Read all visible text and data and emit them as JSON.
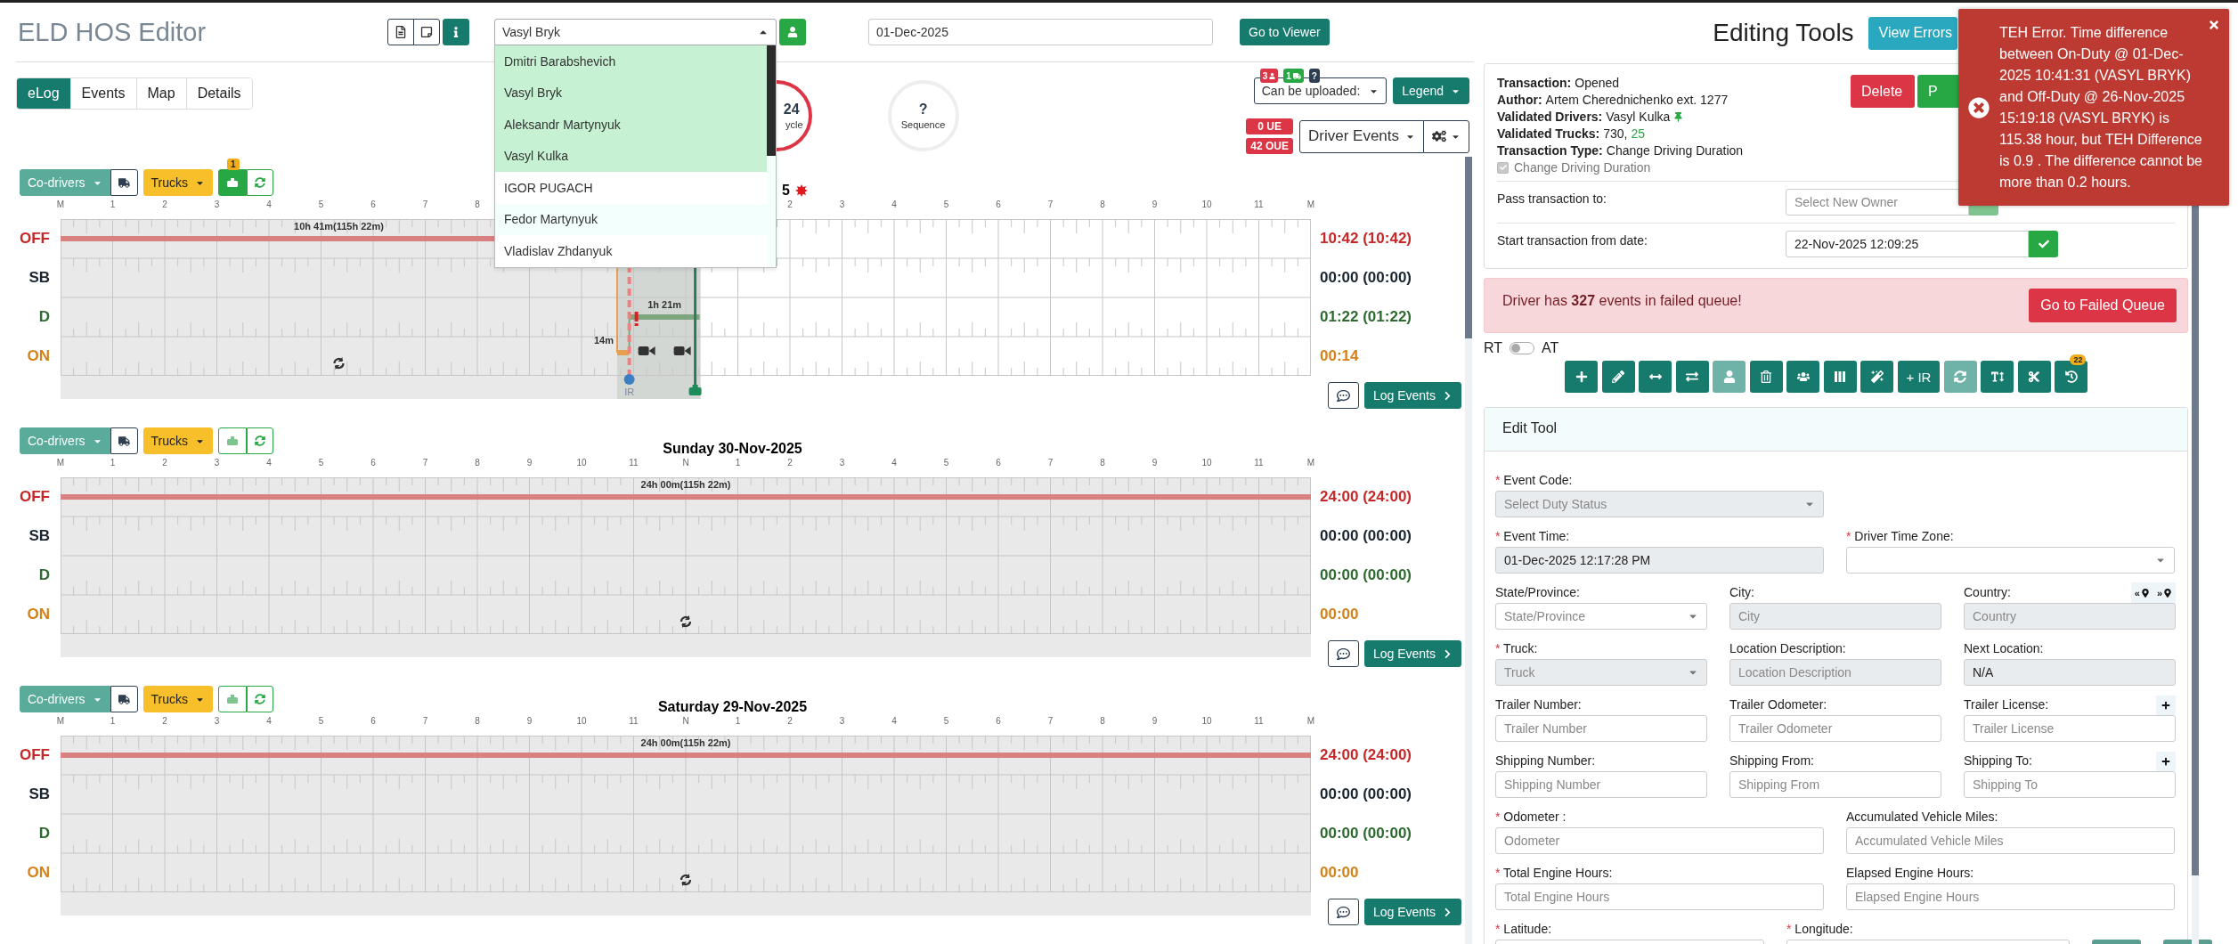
{
  "header": {
    "title": "ELD HOS Editor"
  },
  "driver_select": {
    "value": "Vasyl Bryk",
    "expanded": true,
    "options": [
      {
        "name": "Dmitri Barabshevich",
        "highlighted": true,
        "hovered": false
      },
      {
        "name": "Vasyl Bryk",
        "highlighted": true,
        "hovered": false
      },
      {
        "name": "Aleksandr Martynyuk",
        "highlighted": true,
        "hovered": false
      },
      {
        "name": "Vasyl Kulka",
        "highlighted": true,
        "hovered": false
      },
      {
        "name": "IGOR PUGACH",
        "highlighted": false,
        "hovered": false
      },
      {
        "name": "Fedor Martynyuk",
        "highlighted": false,
        "hovered": true
      },
      {
        "name": "Vladislav Zhdanyuk",
        "highlighted": false,
        "hovered": false
      }
    ]
  },
  "date_field": {
    "value": "01-Dec-2025"
  },
  "viewer_button": "Go to Viewer",
  "tabs": [
    {
      "label": "eLog",
      "selected": true
    },
    {
      "label": "Events",
      "selected": false
    },
    {
      "label": "Map",
      "selected": false
    },
    {
      "label": "Details",
      "selected": false
    }
  ],
  "gauges": [
    {
      "kind": "cycle",
      "value": "24",
      "label": "ycle"
    },
    {
      "kind": "sequence",
      "value": "?",
      "label": "Sequence"
    }
  ],
  "upload": {
    "label": "Can be uploaded:",
    "badges": [
      {
        "kind": "drivers",
        "text": "3"
      },
      {
        "kind": "trucks",
        "text": "1"
      },
      {
        "kind": "help",
        "text": "?"
      }
    ]
  },
  "legend_button": "Legend",
  "error_badges": [
    "0 UE",
    "42 OUE"
  ],
  "events_select": "Driver Events",
  "days": [
    {
      "title": "5",
      "violation": true,
      "codrivers": "Co-drivers",
      "trucks": "Trucks",
      "engine_active": true,
      "engine_badge": "1",
      "hours": [
        "M",
        "1",
        "2",
        "3",
        "4",
        "5",
        "6",
        "7",
        "8"
      ],
      "hours_end": [
        "2",
        "3",
        "4",
        "5",
        "6",
        "7",
        "8",
        "9",
        "10",
        "11",
        "M"
      ],
      "ir_label": "IR",
      "rows": [
        {
          "kind": "off",
          "label": "OFF",
          "total": "10:42 (10:42)"
        },
        {
          "kind": "sb",
          "label": "SB",
          "total": "00:00 (00:00)"
        },
        {
          "kind": "d",
          "label": "D",
          "total": "01:22 (01:22)"
        },
        {
          "kind": "on",
          "label": "ON",
          "total": "00:14"
        }
      ],
      "segments": [
        {
          "kind": "off",
          "label": "10h 41m(115h 22m)"
        },
        {
          "kind": "on",
          "label": "14m"
        },
        {
          "kind": "d",
          "label": "1h 21m"
        }
      ],
      "log_events": "Log Events"
    },
    {
      "title": "Sunday 30-Nov-2025",
      "violation": false,
      "codrivers": "Co-drivers",
      "trucks": "Trucks",
      "engine_active": false,
      "hours": [
        "M",
        "1",
        "2",
        "3",
        "4",
        "5",
        "6",
        "7",
        "8",
        "9",
        "10",
        "11",
        "N",
        "1",
        "2",
        "3",
        "4",
        "5",
        "6",
        "7",
        "8",
        "9",
        "10",
        "11",
        "M"
      ],
      "rows": [
        {
          "kind": "off",
          "label": "OFF",
          "total": "24:00 (24:00)"
        },
        {
          "kind": "sb",
          "label": "SB",
          "total": "00:00 (00:00)"
        },
        {
          "kind": "d",
          "label": "D",
          "total": "00:00 (00:00)"
        },
        {
          "kind": "on",
          "label": "ON",
          "total": "00:00"
        }
      ],
      "segments": [
        {
          "kind": "off",
          "label": "24h 00m(115h 22m)"
        }
      ],
      "log_events": "Log Events"
    },
    {
      "title": "Saturday 29-Nov-2025",
      "violation": false,
      "codrivers": "Co-drivers",
      "trucks": "Trucks",
      "engine_active": false,
      "hours": [
        "M",
        "1",
        "2",
        "3",
        "4",
        "5",
        "6",
        "7",
        "8",
        "9",
        "10",
        "11",
        "N",
        "1",
        "2",
        "3",
        "4",
        "5",
        "6",
        "7",
        "8",
        "9",
        "10",
        "11",
        "M"
      ],
      "rows": [
        {
          "kind": "off",
          "label": "OFF",
          "total": "24:00 (24:00)"
        },
        {
          "kind": "sb",
          "label": "SB",
          "total": "00:00 (00:00)"
        },
        {
          "kind": "d",
          "label": "D",
          "total": "00:00 (00:00)"
        },
        {
          "kind": "on",
          "label": "ON",
          "total": "00:00"
        }
      ],
      "segments": [
        {
          "kind": "off",
          "label": "24h 00m(115h 22m)"
        }
      ],
      "log_events": "Log Events"
    }
  ],
  "editing": {
    "title": "Editing Tools",
    "view_errors": "View Errors",
    "transaction": {
      "lines": [
        {
          "label": "Transaction:",
          "value": "Opened"
        },
        {
          "label": "Author:",
          "value": "Artem Cherednichenko ext. 1277"
        },
        {
          "label": "Validated Drivers:",
          "value": "Vasyl Kulka",
          "pinned": true
        },
        {
          "label": "Validated Trucks:",
          "value": "730,",
          "extra": "25"
        },
        {
          "label": "Transaction Type:",
          "value": "Change Driving Duration"
        }
      ],
      "checkbox": {
        "label": "Change Driving Duration",
        "checked": true
      },
      "buttons": [
        {
          "kind": "delete",
          "label": "Delete"
        },
        {
          "kind": "proceed",
          "label": "P"
        }
      ],
      "pass_to": {
        "label": "Pass transaction to:",
        "placeholder": "Select New Owner"
      },
      "start_date": {
        "label": "Start transaction from date:",
        "value": "22-Nov-2025 12:09:25"
      }
    },
    "failed_alert": {
      "text": "Driver has **327** events in failed queue!",
      "button": "Go to Failed Queue"
    },
    "mode_toggle": {
      "left": "RT",
      "right": "AT",
      "on": false
    },
    "tools": [
      {
        "kind": "add",
        "disabled": false
      },
      {
        "kind": "edit",
        "disabled": false
      },
      {
        "kind": "stretch",
        "disabled": false
      },
      {
        "kind": "swap",
        "disabled": false
      },
      {
        "kind": "driver",
        "disabled": true
      },
      {
        "kind": "delete",
        "disabled": false
      },
      {
        "kind": "drivers",
        "disabled": false
      },
      {
        "kind": "split",
        "disabled": false
      },
      {
        "kind": "magic",
        "disabled": false
      },
      {
        "kind": "ir",
        "label": "+ IR",
        "disabled": false
      },
      {
        "kind": "refresh",
        "disabled": true
      },
      {
        "kind": "text",
        "disabled": false
      },
      {
        "kind": "cut",
        "disabled": false
      },
      {
        "kind": "history",
        "badge": "22",
        "disabled": false
      }
    ],
    "edit_tool": {
      "title": "Edit Tool",
      "rows": [
        {
          "kind": "single",
          "fields": [
            {
              "label": "Event Code:",
              "asterisk": "*",
              "kind": "select",
              "placeholder": "Select Duty Status",
              "disabled": true
            }
          ]
        },
        {
          "kind": "pair",
          "fields": [
            {
              "label": "Event Time:",
              "asterisk": "*",
              "kind": "text",
              "value": "01-Dec-2025 12:17:28 PM",
              "disabled": true
            },
            {
              "label": "Driver Time Zone:",
              "asterisk": "*",
              "kind": "select",
              "disabled": false
            }
          ]
        },
        {
          "kind": "triple",
          "fields": [
            {
              "label": "State/Province:",
              "kind": "select",
              "placeholder": "State/Province",
              "disabled": false
            },
            {
              "label": "City:",
              "kind": "text",
              "placeholder": "City",
              "disabled": true
            },
            {
              "label": "Country:",
              "kind": "text",
              "placeholder": "Country",
              "disabled": true,
              "locate": [
                "«",
                "»"
              ]
            }
          ]
        },
        {
          "kind": "triple",
          "fields": [
            {
              "label": "Truck:",
              "asterisk": "*",
              "kind": "select",
              "placeholder": "Truck",
              "disabled": true
            },
            {
              "label": "Location Description:",
              "kind": "text",
              "placeholder": "Location Description",
              "disabled": true
            },
            {
              "label": "Next Location:",
              "kind": "text",
              "value": "N/A",
              "disabled": true
            }
          ]
        },
        {
          "kind": "triple",
          "fields": [
            {
              "label": "Trailer Number:",
              "kind": "text",
              "placeholder": "Trailer Number",
              "disabled": false
            },
            {
              "label": "Trailer Odometer:",
              "kind": "text",
              "placeholder": "Trailer Odometer",
              "disabled": false
            },
            {
              "label": "Trailer License:",
              "kind": "text",
              "placeholder": "Trailer License",
              "disabled": false,
              "add": true
            }
          ]
        },
        {
          "kind": "triple",
          "fields": [
            {
              "label": "Shipping Number:",
              "kind": "text",
              "placeholder": "Shipping Number",
              "disabled": false
            },
            {
              "label": "Shipping From:",
              "kind": "text",
              "placeholder": "Shipping From",
              "disabled": false
            },
            {
              "label": "Shipping To:",
              "kind": "text",
              "placeholder": "Shipping To",
              "disabled": false,
              "add": true
            }
          ]
        },
        {
          "kind": "pair",
          "fields": [
            {
              "label": "Odometer :",
              "asterisk": "*",
              "kind": "text",
              "placeholder": "Odometer",
              "disabled": false
            },
            {
              "label": "Accumulated Vehicle Miles:",
              "kind": "text",
              "placeholder": "Accumulated Vehicle Miles",
              "disabled": false
            }
          ]
        },
        {
          "kind": "pair",
          "fields": [
            {
              "label": "Total Engine Hours:",
              "asterisk": "*",
              "kind": "text",
              "placeholder": "Total Engine Hours",
              "disabled": false
            },
            {
              "label": "Elapsed Engine Hours:",
              "kind": "text",
              "placeholder": "Elapsed Engine Hours",
              "disabled": false
            }
          ]
        },
        {
          "kind": "coords",
          "fields": [
            {
              "label": "Latitude:",
              "asterisk": "*",
              "kind": "text"
            },
            {
              "label": "Longitude:",
              "asterisk": "*",
              "kind": "text"
            }
          ]
        }
      ]
    }
  },
  "toast": {
    "message": "TEH Error. Time difference between On-Duty @ 01-Dec-2025 10:41:31 (VASYL BRYK) and Off-Duty @ 26-Nov-2025 15:19:18 (VASYL BRYK) is 115.38 hour, but TEH Difference is 0.9 . The difference cannot be more than 0.2 hours."
  }
}
